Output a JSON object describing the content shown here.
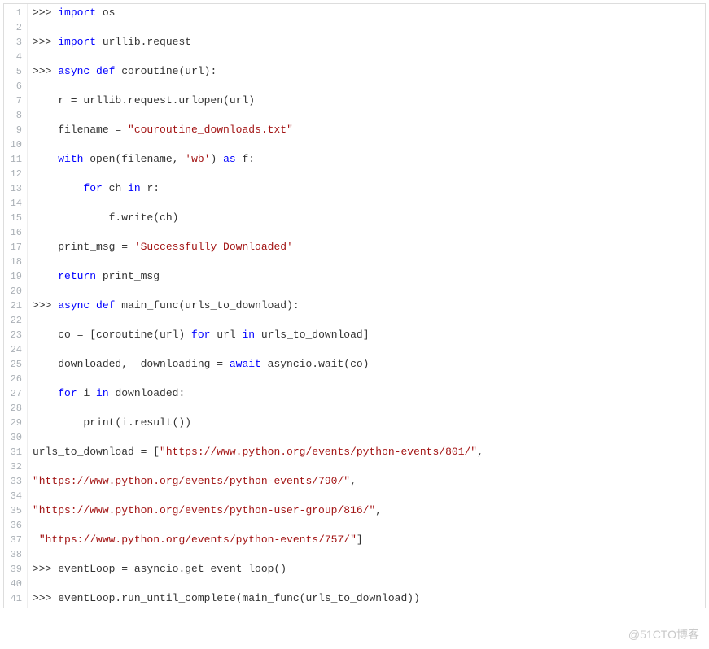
{
  "watermark": "@51CTO博客",
  "lines": [
    {
      "n": 1,
      "tokens": [
        [
          ">>> ",
          "prompt"
        ],
        [
          "import ",
          "kw"
        ],
        [
          "os",
          "name"
        ]
      ]
    },
    {
      "n": 2,
      "tokens": [
        [
          "",
          "name"
        ]
      ]
    },
    {
      "n": 3,
      "tokens": [
        [
          ">>> ",
          "prompt"
        ],
        [
          "import ",
          "kw"
        ],
        [
          "urllib.request",
          "name"
        ]
      ]
    },
    {
      "n": 4,
      "tokens": [
        [
          "",
          "name"
        ]
      ]
    },
    {
      "n": 5,
      "tokens": [
        [
          ">>> ",
          "prompt"
        ],
        [
          "async ",
          "kw"
        ],
        [
          "def ",
          "kw"
        ],
        [
          "coroutine",
          "fn"
        ],
        [
          "(url):",
          "name"
        ]
      ]
    },
    {
      "n": 6,
      "tokens": [
        [
          "",
          "name"
        ]
      ]
    },
    {
      "n": 7,
      "tokens": [
        [
          "    r = urllib.request.urlopen(url)",
          "name"
        ]
      ]
    },
    {
      "n": 8,
      "tokens": [
        [
          "",
          "name"
        ]
      ]
    },
    {
      "n": 9,
      "tokens": [
        [
          "    filename = ",
          "name"
        ],
        [
          "\"couroutine_downloads.txt\"",
          "str"
        ]
      ]
    },
    {
      "n": 10,
      "tokens": [
        [
          "",
          "name"
        ]
      ]
    },
    {
      "n": 11,
      "tokens": [
        [
          "    ",
          "name"
        ],
        [
          "with ",
          "kw"
        ],
        [
          "open(filename, ",
          "name"
        ],
        [
          "'wb'",
          "str"
        ],
        [
          ") ",
          "name"
        ],
        [
          "as ",
          "kw"
        ],
        [
          "f:",
          "name"
        ]
      ]
    },
    {
      "n": 12,
      "tokens": [
        [
          "",
          "name"
        ]
      ]
    },
    {
      "n": 13,
      "tokens": [
        [
          "        ",
          "name"
        ],
        [
          "for ",
          "kw"
        ],
        [
          "ch ",
          "name"
        ],
        [
          "in ",
          "kw"
        ],
        [
          "r:",
          "name"
        ]
      ]
    },
    {
      "n": 14,
      "tokens": [
        [
          "",
          "name"
        ]
      ]
    },
    {
      "n": 15,
      "tokens": [
        [
          "            f.write(ch)",
          "name"
        ]
      ]
    },
    {
      "n": 16,
      "tokens": [
        [
          "",
          "name"
        ]
      ]
    },
    {
      "n": 17,
      "tokens": [
        [
          "    print_msg = ",
          "name"
        ],
        [
          "'Successfully Downloaded'",
          "str"
        ]
      ]
    },
    {
      "n": 18,
      "tokens": [
        [
          "",
          "name"
        ]
      ]
    },
    {
      "n": 19,
      "tokens": [
        [
          "    ",
          "name"
        ],
        [
          "return ",
          "kw"
        ],
        [
          "print_msg",
          "name"
        ]
      ]
    },
    {
      "n": 20,
      "tokens": [
        [
          "",
          "name"
        ]
      ]
    },
    {
      "n": 21,
      "tokens": [
        [
          ">>> ",
          "prompt"
        ],
        [
          "async ",
          "kw"
        ],
        [
          "def ",
          "kw"
        ],
        [
          "main_func",
          "fn"
        ],
        [
          "(urls_to_download):",
          "name"
        ]
      ]
    },
    {
      "n": 22,
      "tokens": [
        [
          "",
          "name"
        ]
      ]
    },
    {
      "n": 23,
      "tokens": [
        [
          "    co = [coroutine(url) ",
          "name"
        ],
        [
          "for ",
          "kw"
        ],
        [
          "url ",
          "name"
        ],
        [
          "in ",
          "kw"
        ],
        [
          "urls_to_download]",
          "name"
        ]
      ]
    },
    {
      "n": 24,
      "tokens": [
        [
          "",
          "name"
        ]
      ]
    },
    {
      "n": 25,
      "tokens": [
        [
          "    downloaded,  downloading = ",
          "name"
        ],
        [
          "await ",
          "kw"
        ],
        [
          "asyncio.wait(co)",
          "name"
        ]
      ]
    },
    {
      "n": 26,
      "tokens": [
        [
          "",
          "name"
        ]
      ]
    },
    {
      "n": 27,
      "tokens": [
        [
          "    ",
          "name"
        ],
        [
          "for ",
          "kw"
        ],
        [
          "i ",
          "name"
        ],
        [
          "in ",
          "kw"
        ],
        [
          "downloaded:",
          "name"
        ]
      ]
    },
    {
      "n": 28,
      "tokens": [
        [
          "",
          "name"
        ]
      ]
    },
    {
      "n": 29,
      "tokens": [
        [
          "        print(i.result())",
          "name"
        ]
      ]
    },
    {
      "n": 30,
      "tokens": [
        [
          "",
          "name"
        ]
      ]
    },
    {
      "n": 31,
      "tokens": [
        [
          "urls_to_download = [",
          "name"
        ],
        [
          "\"https://www.python.org/events/python-events/801/\"",
          "str"
        ],
        [
          ",",
          "name"
        ]
      ]
    },
    {
      "n": 32,
      "tokens": [
        [
          "",
          "name"
        ]
      ]
    },
    {
      "n": 33,
      "tokens": [
        [
          "",
          "name"
        ],
        [
          "\"https://www.python.org/events/python-events/790/\"",
          "str"
        ],
        [
          ",",
          "name"
        ]
      ]
    },
    {
      "n": 34,
      "tokens": [
        [
          "",
          "name"
        ]
      ]
    },
    {
      "n": 35,
      "tokens": [
        [
          "",
          "name"
        ],
        [
          "\"https://www.python.org/events/python-user-group/816/\"",
          "str"
        ],
        [
          ",",
          "name"
        ]
      ]
    },
    {
      "n": 36,
      "tokens": [
        [
          "",
          "name"
        ]
      ]
    },
    {
      "n": 37,
      "tokens": [
        [
          " ",
          "name"
        ],
        [
          "\"https://www.python.org/events/python-events/757/\"",
          "str"
        ],
        [
          "]",
          "name"
        ]
      ]
    },
    {
      "n": 38,
      "tokens": [
        [
          "",
          "name"
        ]
      ]
    },
    {
      "n": 39,
      "tokens": [
        [
          ">>> ",
          "prompt"
        ],
        [
          "eventLoop = asyncio.get_event_loop()",
          "name"
        ]
      ]
    },
    {
      "n": 40,
      "tokens": [
        [
          "",
          "name"
        ]
      ]
    },
    {
      "n": 41,
      "tokens": [
        [
          ">>> ",
          "prompt"
        ],
        [
          "eventLoop.run_until_complete(main_func(urls_to_download))",
          "name"
        ]
      ]
    }
  ]
}
